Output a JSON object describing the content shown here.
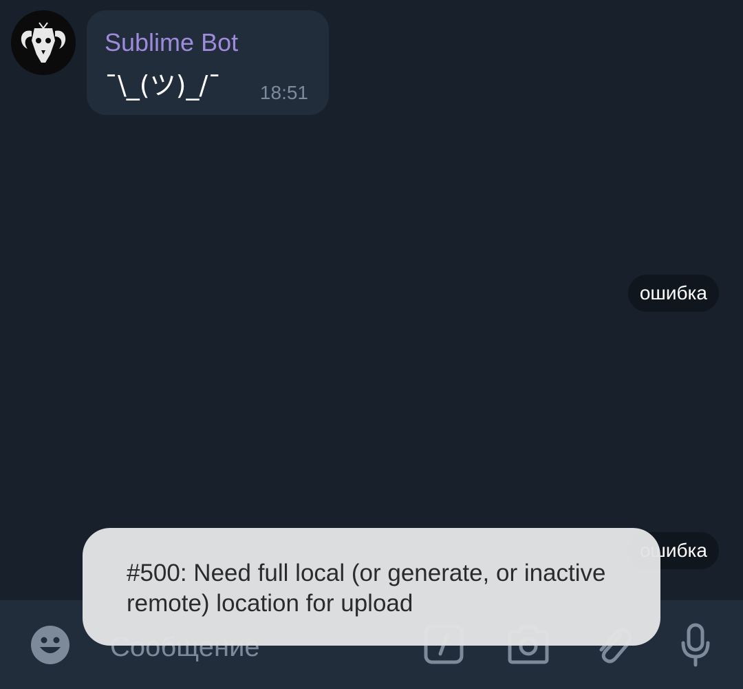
{
  "chat": {
    "incoming": {
      "sender": "Sublime Bot",
      "text": "¯\\_(ツ)_/¯",
      "time": "18:51"
    },
    "outgoing": [
      {
        "text": "ошибка"
      },
      {
        "text": "ошибка"
      }
    ]
  },
  "composer": {
    "placeholder": "Сообщение",
    "icons": [
      "emoji-icon",
      "slash-command-icon",
      "camera-icon",
      "paperclip-icon",
      "microphone-icon"
    ]
  },
  "toast": {
    "message": "#500: Need full local (or generate, or inactive remote) location for upload"
  },
  "colors": {
    "background": "#18202b",
    "bubble": "#212d3b",
    "sender_name": "#9f8bdc",
    "icon": "#7c8a99",
    "toast_bg": "#e2e3e4"
  }
}
